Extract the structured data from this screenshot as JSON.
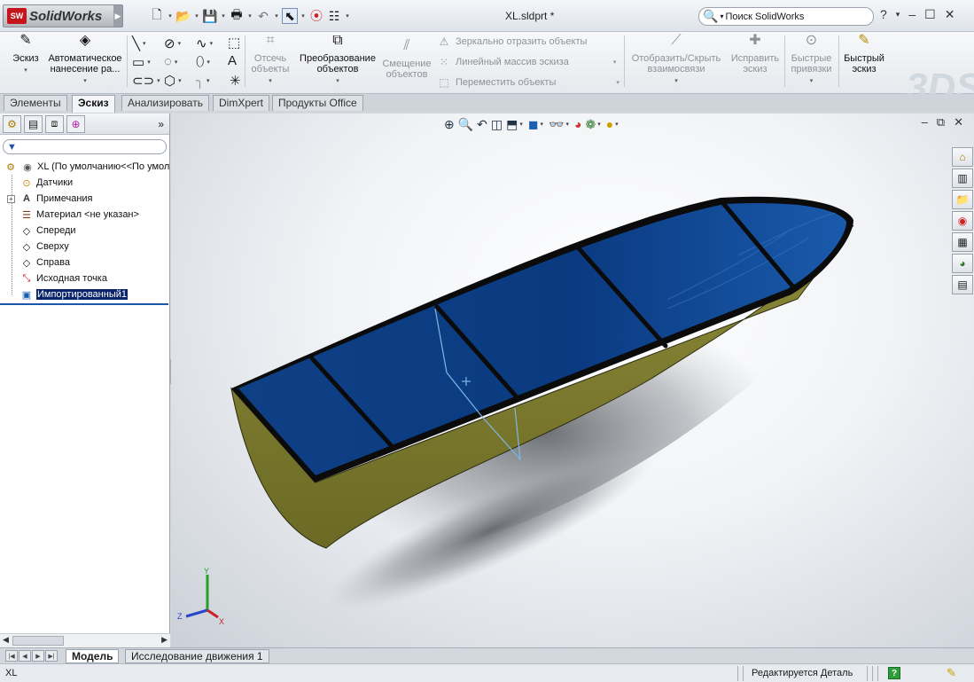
{
  "app": {
    "logo_text": "SolidWorks",
    "logo_mark": "SW",
    "document_title": "XL.sldprt *"
  },
  "search": {
    "placeholder": "Поиск SolidWorks"
  },
  "window_controls": [
    "?",
    "▾",
    "–",
    "☐",
    "✕"
  ],
  "command_manager": {
    "sketch": "Эскиз",
    "smart_dimension": "Автоматическое нанесение ра...",
    "trim": "Отсечь объекты",
    "convert": "Преобразование объектов",
    "offset": "Смещение объектов",
    "mirror": "Зеркально отразить объекты",
    "linear_pattern": "Линейный массив эскиза",
    "move": "Переместить объекты",
    "show_hide_relations": "Отобразить/Скрыть взаимосвязи",
    "repair_sketch": "Исправить эскиз",
    "quick_snaps": "Быстрые привязки",
    "rapid_sketch": "Быстрый эскиз"
  },
  "tabs": [
    "Элементы",
    "Эскиз",
    "Анализировать",
    "DimXpert",
    "Продукты Office"
  ],
  "active_tab": "Эскиз",
  "feature_tree": {
    "root": "XL  (По умолчанию<<По умол",
    "items": [
      {
        "label": "Датчики",
        "icon": "sensor-icon"
      },
      {
        "label": "Примечания",
        "icon": "annotation-icon"
      },
      {
        "label": "Материал <не указан>",
        "icon": "material-icon"
      },
      {
        "label": "Спереди",
        "icon": "plane-icon"
      },
      {
        "label": "Сверху",
        "icon": "plane-icon"
      },
      {
        "label": "Справа",
        "icon": "plane-icon"
      },
      {
        "label": "Исходная точка",
        "icon": "origin-icon"
      },
      {
        "label": "Импортированный1",
        "icon": "imported-body-icon"
      }
    ]
  },
  "triad": {
    "y": "Y",
    "z": "Z",
    "x": "X"
  },
  "bottom_tabs": [
    "Модель",
    "Исследование движения 1"
  ],
  "status": {
    "left": "XL",
    "mode": "Редактируется Деталь"
  },
  "colors": {
    "boat_deck": "#0a3f88",
    "boat_hull": "#7c7a2a",
    "selection": "#0a246a",
    "sketch_line": "#7fb7e6"
  }
}
